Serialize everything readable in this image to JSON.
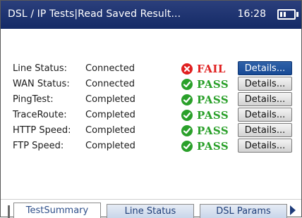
{
  "header": {
    "title": "DSL / IP Tests|Read Saved Result...",
    "time": "16:28",
    "battery_icon": "battery-icon"
  },
  "colors": {
    "header_bg": "#1f3574",
    "fail": "#e02020",
    "pass": "#2aa02a",
    "selected_button": "#235aa0",
    "tab_text": "#1f3e78"
  },
  "results": [
    {
      "label": "Line Status:",
      "value": "Connected",
      "result": "FAIL",
      "icon": "fail-x-icon",
      "button": "Details..."
    },
    {
      "label": "WAN Status:",
      "value": "Connected",
      "result": "PASS",
      "icon": "pass-check-icon",
      "button": "Details..."
    },
    {
      "label": "PingTest:",
      "value": "Completed",
      "result": "PASS",
      "icon": "pass-check-icon",
      "button": "Details..."
    },
    {
      "label": "TraceRoute:",
      "value": "Completed",
      "result": "PASS",
      "icon": "pass-check-icon",
      "button": "Details..."
    },
    {
      "label": "HTTP Speed:",
      "value": "Completed",
      "result": "PASS",
      "icon": "pass-check-icon",
      "button": "Details..."
    },
    {
      "label": "FTP Speed:",
      "value": "Completed",
      "result": "PASS",
      "icon": "pass-check-icon",
      "button": "Details..."
    }
  ],
  "tabs": [
    {
      "label": "TestSummary",
      "active": true
    },
    {
      "label": "Line Status",
      "active": false
    },
    {
      "label": "DSL Params",
      "active": false
    }
  ],
  "tab_scroll_icon": "arrow-right-icon"
}
